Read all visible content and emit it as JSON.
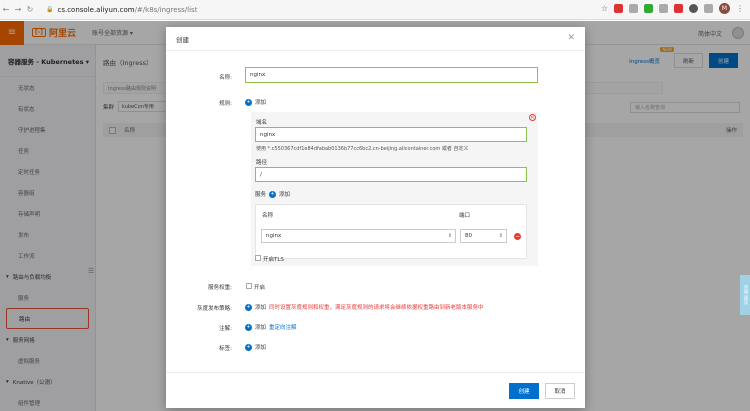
{
  "browser": {
    "url_host": "cs.console.aliyun.com",
    "url_path": "/#/k8s/ingress/list"
  },
  "topbar": {
    "logo_text": "阿里云",
    "menu_label": "账号全部资源 ▾",
    "right_label": "简体中文"
  },
  "sidebar": {
    "title": "容器服务 - Kubernetes ▾",
    "items": [
      {
        "label": "无状态",
        "type": "item"
      },
      {
        "label": "有状态",
        "type": "item"
      },
      {
        "label": "守护进程集",
        "type": "item"
      },
      {
        "label": "任务",
        "type": "item"
      },
      {
        "label": "定时任务",
        "type": "item"
      },
      {
        "label": "容器组",
        "type": "item"
      },
      {
        "label": "存储声明",
        "type": "item"
      },
      {
        "label": "发布",
        "type": "item"
      },
      {
        "label": "工作流",
        "type": "item"
      },
      {
        "label": "路由与负载均衡",
        "type": "group"
      },
      {
        "label": "服务",
        "type": "item"
      },
      {
        "label": "路由",
        "type": "item",
        "active": true
      },
      {
        "label": "服务网格",
        "type": "group"
      },
      {
        "label": "虚拟服务",
        "type": "item"
      },
      {
        "label": "Knative（公测）",
        "type": "group"
      },
      {
        "label": "组件管理",
        "type": "item"
      }
    ]
  },
  "main": {
    "breadcrumb": "路由（Ingress）",
    "ingress_overview": "Ingress概览",
    "badge": "NEW",
    "refresh": "刷新",
    "create": "创建",
    "tip": "Ingress路由规则说明",
    "namespace_label": "集群",
    "namespace_value": "kubeCon专用",
    "name_search_placeholder": "输入名称查询",
    "col_name": "名称",
    "col_ops": "操作"
  },
  "side_tab": "咨询·建议",
  "dialog": {
    "title": "创建",
    "name_label": "名称:",
    "name_value": "nginx",
    "rules_label": "规则:",
    "add": "添加",
    "domain_label": "域名",
    "domain_value": "nginx",
    "domain_hint": "使用 *.c550367cdf1e84dfabab0136b77cc6bc2.cn-beijing.alicontainer.com 或者 自定义",
    "path_label": "路径",
    "path_value": "/",
    "service_label": "服务",
    "svc_col_name": "名称",
    "svc_col_port": "端口",
    "svc_name_value": "nginx",
    "svc_port_value": "80",
    "tls_label": "开启TLS",
    "weight_label": "服务权重:",
    "weight_checkbox": "开启",
    "gray_label": "灰度发布策略:",
    "gray_hint": "同时设置灰度规则和权重，满足灰度规则的请求将会继续依据权重路由到新老版本服务中",
    "annotation_label": "注解:",
    "annotation_link": "重定向注解",
    "tags_label": "标签:",
    "create_btn": "创建",
    "cancel_btn": "取消"
  }
}
